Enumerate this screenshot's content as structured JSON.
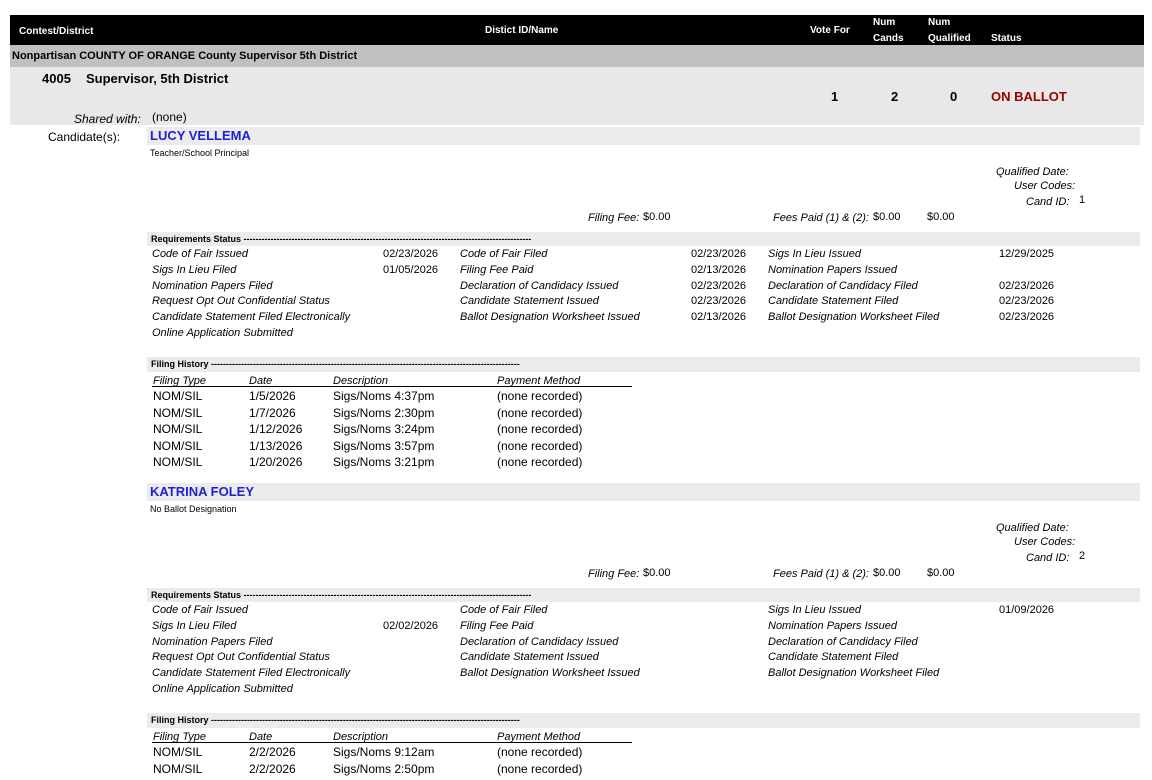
{
  "header": {
    "contest_district": "Contest/District",
    "district_id_name": "Distict ID/Name",
    "vote_for": "Vote For",
    "num_cands": [
      "Num",
      "Cands"
    ],
    "num_qualified": [
      "Num",
      "Qualified"
    ],
    "status": "Status"
  },
  "contest": {
    "title": "Nonpartisan COUNTY OF ORANGE  County Supervisor 5th District",
    "number": "4005",
    "name": "Supervisor, 5th District",
    "vote_for": "1",
    "num_cands": "2",
    "num_qualified": "0",
    "status": "ON BALLOT",
    "shared_with_label": "Shared with:",
    "shared_with": "(none)",
    "candidates_label": "Candidate(s):"
  },
  "labels": {
    "qualified_date": "Qualified Date:",
    "user_codes": "User Codes:",
    "cand_id": "Cand ID:",
    "filing_fee": "Filing Fee:",
    "fees_paid": "Fees Paid (1) & (2):",
    "requirements_status": "Requirements Status  ------------------------------------------------------------------------------------------------",
    "filing_history": "Filing History -------------------------------------------------------------------------------------------------------",
    "fh_cols": [
      "Filing Type",
      "Date",
      "Description",
      "Payment Method"
    ]
  },
  "candidates": [
    {
      "name": "LUCY VELLEMA",
      "designation": "Teacher/School Principal",
      "cand_id": "1",
      "filing_fee": "$0.00",
      "fees_paid_1": "$0.00",
      "fees_paid_2": "$0.00",
      "requirements": {
        "col1": [
          {
            "label": "Code of Fair Issued",
            "date": "02/23/2026"
          },
          {
            "label": "Sigs In Lieu Filed",
            "date": "01/05/2026"
          },
          {
            "label": "Nomination Papers Filed",
            "date": ""
          },
          {
            "label": "Request Opt Out Confidential Status",
            "date": ""
          },
          {
            "label": "Candidate Statement Filed Electronically",
            "date": ""
          },
          {
            "label": "Online Application Submitted",
            "date": ""
          }
        ],
        "col2": [
          {
            "label": "Code of Fair Filed",
            "date": "02/23/2026"
          },
          {
            "label": "Filing Fee Paid",
            "date": "02/13/2026"
          },
          {
            "label": "Declaration of Candidacy Issued",
            "date": "02/23/2026"
          },
          {
            "label": "Candidate Statement Issued",
            "date": "02/23/2026"
          },
          {
            "label": "Ballot Designation Worksheet Issued",
            "date": "02/13/2026"
          }
        ],
        "col3": [
          {
            "label": "Sigs In Lieu Issued",
            "date": "12/29/2025"
          },
          {
            "label": "Nomination Papers Issued",
            "date": ""
          },
          {
            "label": "Declaration of Candidacy Filed",
            "date": "02/23/2026"
          },
          {
            "label": "Candidate Statement Filed",
            "date": "02/23/2026"
          },
          {
            "label": "Ballot Designation Worksheet Filed",
            "date": "02/23/2026"
          }
        ]
      },
      "filing_history": [
        {
          "type": "NOM/SIL",
          "date": "1/5/2026",
          "desc": "Sigs/Noms 4:37pm",
          "payment": "(none recorded)"
        },
        {
          "type": "NOM/SIL",
          "date": "1/7/2026",
          "desc": "Sigs/Noms 2:30pm",
          "payment": "(none recorded)"
        },
        {
          "type": "NOM/SIL",
          "date": "1/12/2026",
          "desc": "Sigs/Noms 3:24pm",
          "payment": "(none recorded)"
        },
        {
          "type": "NOM/SIL",
          "date": "1/13/2026",
          "desc": "Sigs/Noms 3:57pm",
          "payment": "(none recorded)"
        },
        {
          "type": "NOM/SIL",
          "date": "1/20/2026",
          "desc": "Sigs/Noms 3:21pm",
          "payment": "(none recorded)"
        }
      ]
    },
    {
      "name": "KATRINA FOLEY",
      "designation": "No Ballot Designation",
      "cand_id": "2",
      "filing_fee": "$0.00",
      "fees_paid_1": "$0.00",
      "fees_paid_2": "$0.00",
      "requirements": {
        "col1": [
          {
            "label": "Code of Fair Issued",
            "date": ""
          },
          {
            "label": "Sigs In Lieu Filed",
            "date": "02/02/2026"
          },
          {
            "label": "Nomination Papers Filed",
            "date": ""
          },
          {
            "label": "Request Opt Out Confidential Status",
            "date": ""
          },
          {
            "label": "Candidate Statement Filed Electronically",
            "date": ""
          },
          {
            "label": "Online Application Submitted",
            "date": ""
          }
        ],
        "col2": [
          {
            "label": "Code of Fair Filed",
            "date": ""
          },
          {
            "label": "Filing Fee Paid",
            "date": ""
          },
          {
            "label": "Declaration of Candidacy Issued",
            "date": ""
          },
          {
            "label": "Candidate Statement Issued",
            "date": ""
          },
          {
            "label": "Ballot Designation Worksheet Issued",
            "date": ""
          }
        ],
        "col3": [
          {
            "label": "Sigs In Lieu Issued",
            "date": "01/09/2026"
          },
          {
            "label": "Nomination Papers Issued",
            "date": ""
          },
          {
            "label": "Declaration of Candidacy Filed",
            "date": ""
          },
          {
            "label": "Candidate Statement Filed",
            "date": ""
          },
          {
            "label": "Ballot Designation Worksheet Filed",
            "date": ""
          }
        ]
      },
      "filing_history": [
        {
          "type": "NOM/SIL",
          "date": "2/2/2026",
          "desc": "Sigs/Noms 9:12am",
          "payment": "(none recorded)"
        },
        {
          "type": "NOM/SIL",
          "date": "2/2/2026",
          "desc": "Sigs/Noms 2:50pm",
          "payment": "(none recorded)"
        }
      ]
    }
  ]
}
